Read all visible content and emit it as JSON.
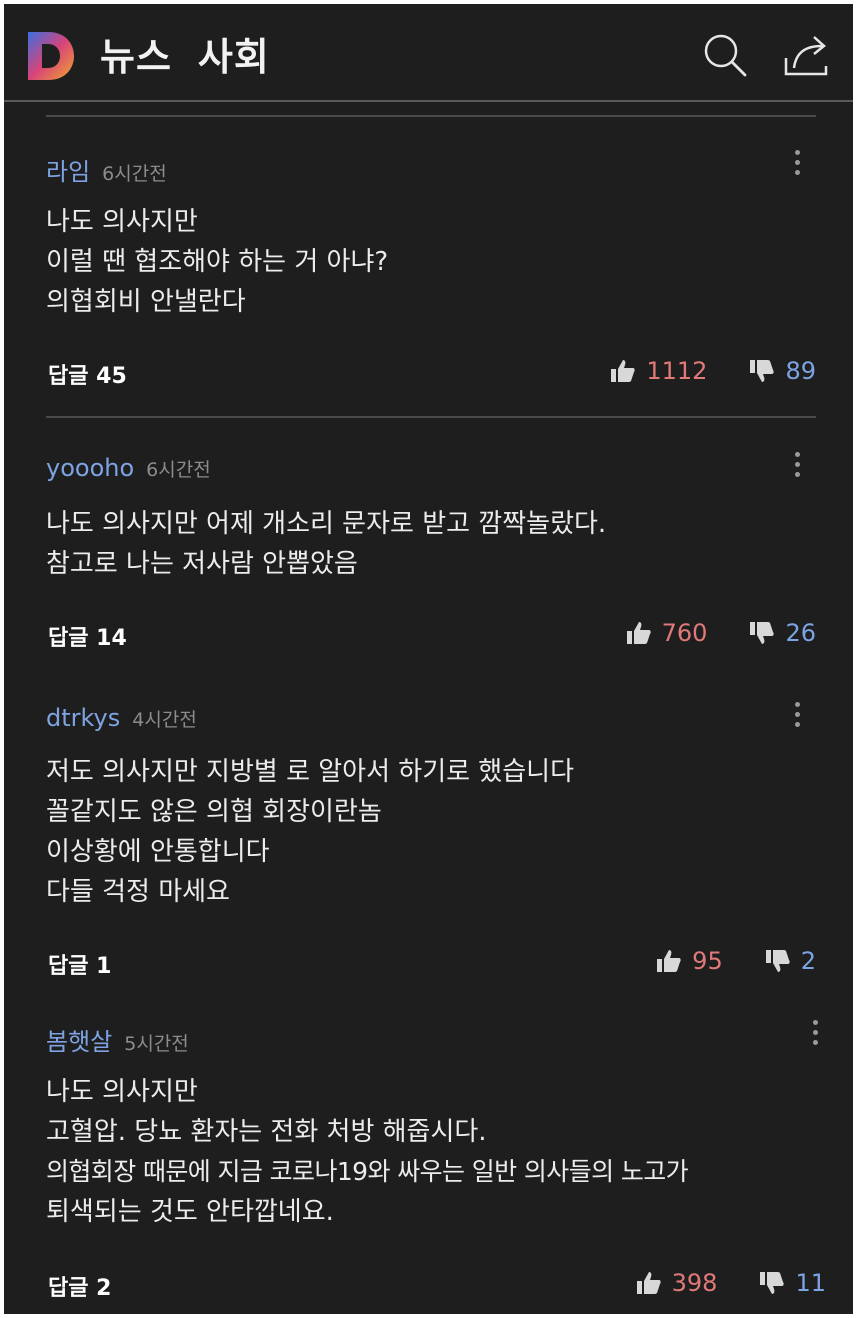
{
  "header": {
    "logo_letter": "D",
    "section": "뉴스",
    "category": "사회"
  },
  "comments": [
    {
      "user": "라임",
      "time": "6시간전",
      "lines": [
        "나도 의사지만",
        "이럴 땐 협조해야 하는 거 아냐?",
        "의협회비 안낼란다"
      ],
      "reply_label": "답글 45",
      "likes": "1112",
      "dislikes": "89"
    },
    {
      "user": "yoooho",
      "time": "6시간전",
      "lines": [
        "나도 의사지만 어제 개소리 문자로 받고 깜짝놀랐다.",
        "참고로 나는 저사람 안뽑았음"
      ],
      "reply_label": "답글 14",
      "likes": "760",
      "dislikes": "26"
    },
    {
      "user": "dtrkys",
      "time": "4시간전",
      "lines": [
        "저도 의사지만  지방별 로 알아서 하기로  했습니다",
        "꼴같지도 않은 의협 회장이란놈",
        "이상황에 안통합니다",
        "다들 걱정 마세요"
      ],
      "reply_label": "답글 1",
      "likes": "95",
      "dislikes": "2"
    },
    {
      "user": "봄햇살",
      "time": "5시간전",
      "lines": [
        "나도 의사지만",
        "고혈압. 당뇨 환자는 전화 처방 해줍시다.",
        "의협회장 때문에 지금 코로나19와 싸우는 일반 의사들의 노고가",
        "퇴색되는 것도 안타깝네요."
      ],
      "reply_label": "답글 2",
      "likes": "398",
      "dislikes": "11"
    }
  ],
  "colors": {
    "background": "#1e1e1f",
    "username": "#7da3e2",
    "likes": "#e07a78",
    "dislikes": "#7da3e2"
  },
  "icons": [
    "logo-icon",
    "search-icon",
    "share-icon",
    "more-options-icon",
    "thumbs-up-icon",
    "thumbs-down-icon"
  ]
}
